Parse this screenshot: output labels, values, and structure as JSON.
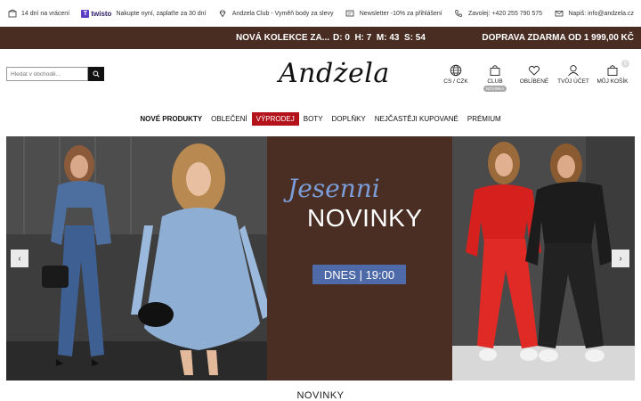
{
  "topbar": [
    {
      "icon": "return-box-icon",
      "text": "14 dní na vrácení"
    },
    {
      "icon": "twisto-logo",
      "brand": "twisto",
      "text": "Nakupte nyní, zaplaťte za 30 dní"
    },
    {
      "icon": "diamond-icon",
      "text": "Andzela Club - Vyměň body za slevy"
    },
    {
      "icon": "newsletter-icon",
      "text": "Newsletter -10% za přihlášení"
    },
    {
      "icon": "phone-icon",
      "text": "Zavolej: +420 255 790 575"
    },
    {
      "icon": "mail-icon",
      "text": "Napiš: info@andzela.cz"
    }
  ],
  "promo": {
    "collection": "NOVÁ KOLEKCE ZA...",
    "countdown": "D: 0  H: 7  M: 43  S: 54",
    "shipping": "DOPRAVA ZDARMA OD 1 999,00 KČ"
  },
  "search": {
    "placeholder": "Hledat v obchodě..."
  },
  "logo": "Andżela",
  "actions": [
    {
      "icon": "globe-icon",
      "label": "CS / CZK"
    },
    {
      "icon": "shopping-bag-icon",
      "label": "CLUB",
      "badge": "NOVINKA"
    },
    {
      "icon": "heart-icon",
      "label": "OBLÍBENÉ"
    },
    {
      "icon": "user-icon",
      "label": "TVŮJ ÚČET"
    },
    {
      "icon": "cart-icon",
      "label": "MŮJ KOŠÍK",
      "count": "0"
    }
  ],
  "nav": [
    {
      "label": "NOVÉ PRODUKTY",
      "style": "bold"
    },
    {
      "label": "OBLEČENÍ",
      "style": "normal"
    },
    {
      "label": "VÝPRODEJ",
      "style": "sale"
    },
    {
      "label": "BOTY",
      "style": "normal"
    },
    {
      "label": "DOPLŇKY",
      "style": "normal"
    },
    {
      "label": "NEJČASTĚJI KUPOVANÉ",
      "style": "normal"
    },
    {
      "label": "PRÉMIUM",
      "style": "normal"
    }
  ],
  "hero": {
    "script_title": "Jesenni",
    "title": "NOVINKY",
    "date_badge": "DNES | 19:00",
    "prev": "‹",
    "next": "›"
  },
  "section_title": "NOVINKY",
  "colors": {
    "promo_bg": "#4a2d22",
    "sale_red": "#b3121b",
    "badge_blue": "#4e6aa8",
    "script_blue": "#7c9ed8"
  }
}
